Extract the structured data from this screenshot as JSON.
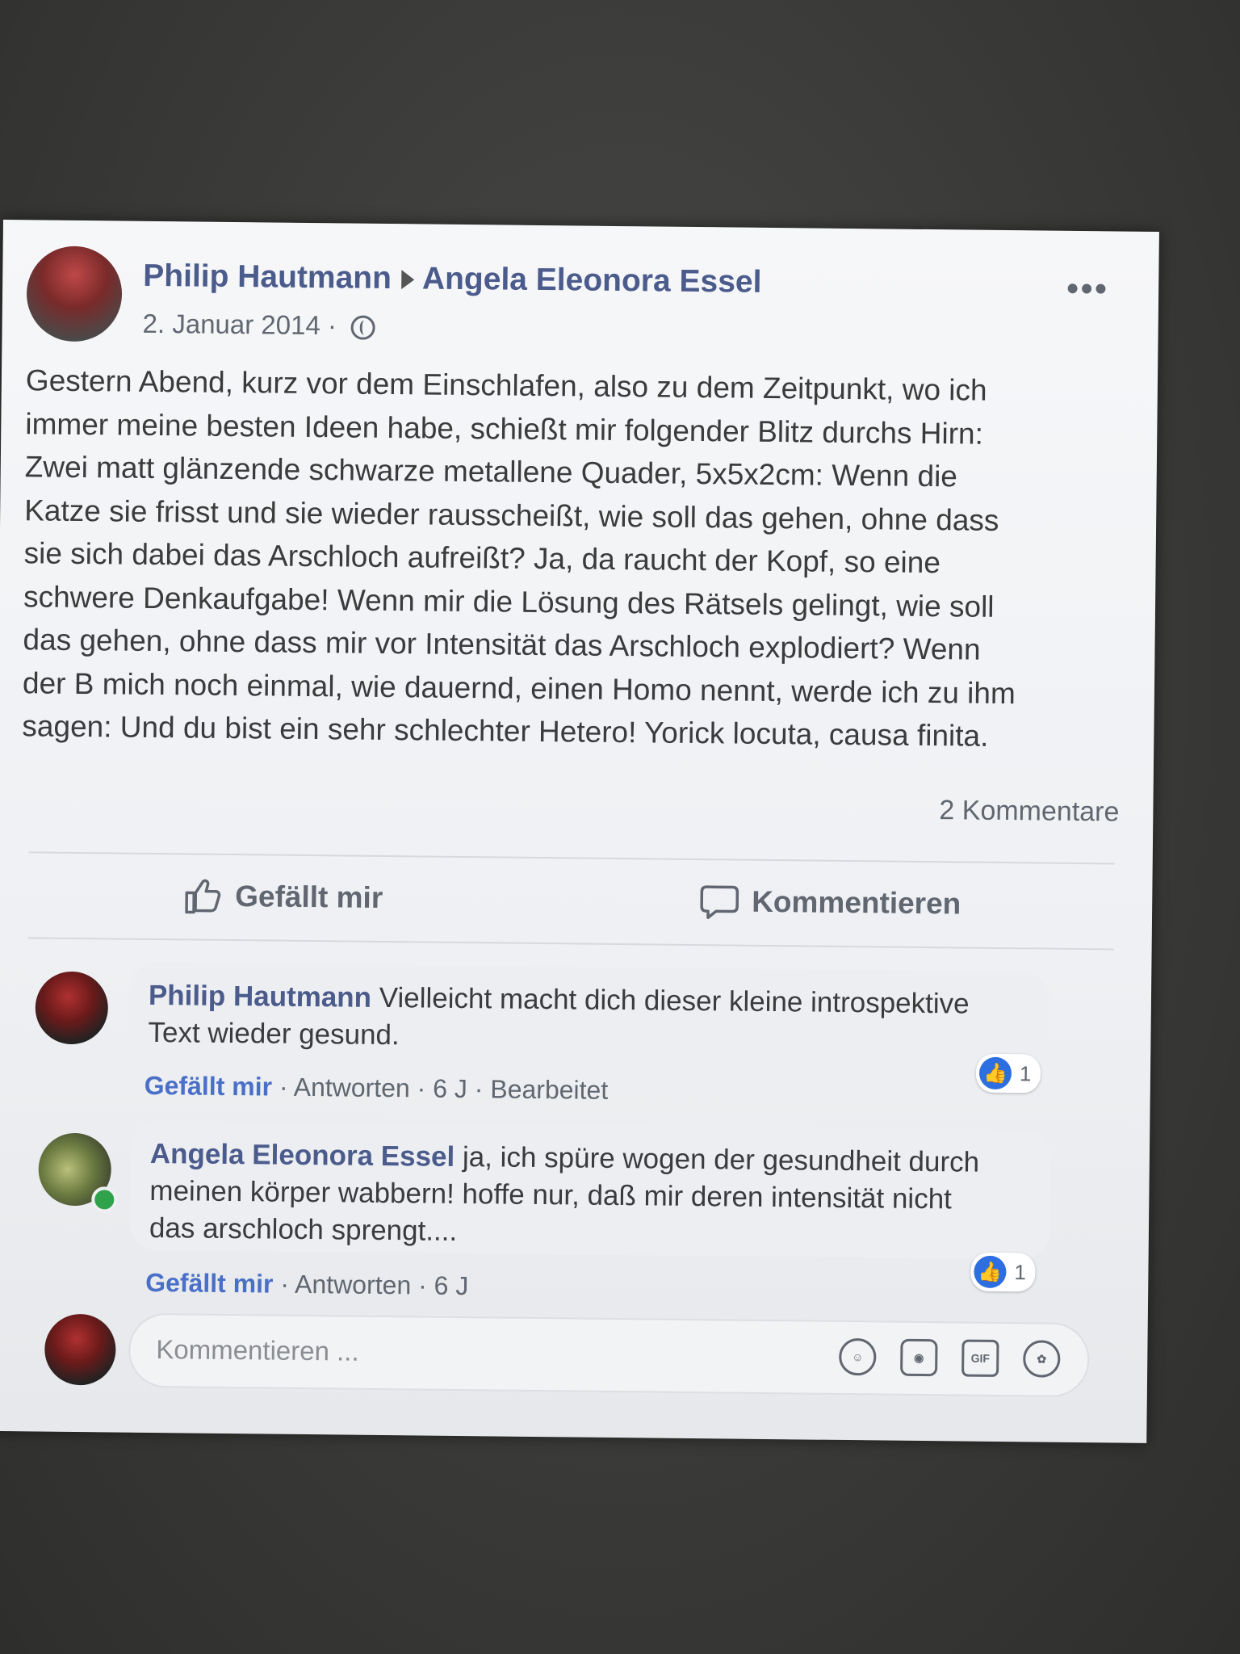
{
  "post": {
    "author": "Philip Hautmann",
    "target": "Angela Eleonora Essel",
    "date": "2. Januar 2014 ·",
    "text": "Gestern Abend, kurz vor dem Einschlafen, also zu dem Zeitpunkt, wo ich\nimmer meine besten Ideen habe, schießt mir folgender Blitz durchs Hirn:\nZwei matt glänzende schwarze metallene Quader, 5x5x2cm: Wenn die\nKatze sie frisst und sie wieder rausscheißt, wie soll das gehen, ohne dass\nsie sich dabei das Arschloch aufreißt? Ja, da raucht der Kopf, so eine\nschwere Denkaufgabe! Wenn mir die Lösung des Rätsels gelingt, wie soll\ndas gehen, ohne dass mir vor Intensität das Arschloch explodiert? Wenn\nder B mich noch einmal, wie dauernd, einen Homo nennt, werde ich zu ihm\nsagen: Und du bist ein sehr schlechter Hetero! Yorick locuta, causa finita.",
    "comment_count": "2 Kommentare",
    "more": "•••"
  },
  "actions": {
    "like": "Gefällt mir",
    "comment": "Kommentieren"
  },
  "comments": [
    {
      "author": "Philip Hautmann",
      "text": "Vielleicht macht dich dieser kleine introspektive\nText wieder gesund.",
      "reactions": "1",
      "like_link": "Gefällt mir",
      "meta": "· Antworten · 6 J · Bearbeitet"
    },
    {
      "author": "Angela Eleonora Essel",
      "text": "ja, ich spüre wogen der gesundheit durch\nmeinen körper wabbern! hoffe nur, daß mir deren intensität nicht\ndas arschloch sprengt....",
      "reactions": "1",
      "like_link": "Gefällt mir",
      "meta": "· Antworten · 6 J"
    }
  ],
  "composer": {
    "placeholder": "Kommentieren ..."
  },
  "icons": {
    "like": "thumbs-up-icon",
    "comment": "speech-bubble-icon",
    "globe": "globe-icon",
    "emoji": "smiley-icon",
    "camera": "camera-icon",
    "gif": "gif-icon",
    "sticker": "sticker-icon"
  },
  "colors": {
    "name_link": "#4b5b8c",
    "like_blue": "#2d6fe0",
    "online": "#31a24c"
  }
}
